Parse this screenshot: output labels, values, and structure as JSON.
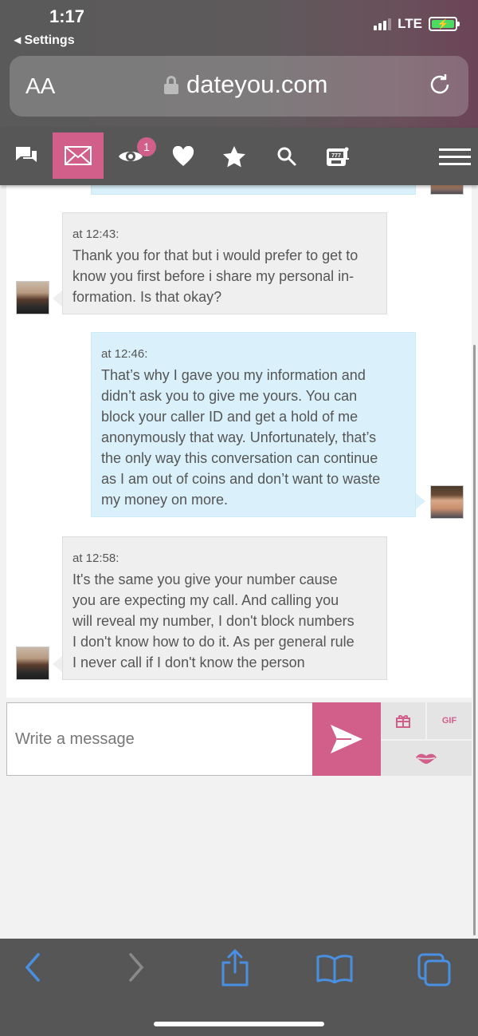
{
  "status": {
    "time": "1:17",
    "back_label": "◂ Settings",
    "network": "LTE"
  },
  "browser": {
    "text_size_label": "AA",
    "domain": "dateyou.com"
  },
  "nav": {
    "items": [
      "messages-icon",
      "mail-icon",
      "eye-icon",
      "heart-icon",
      "star-icon",
      "search-icon",
      "slot-machine-icon",
      "menu-icon"
    ],
    "active": "mail-icon",
    "views_badge": "1"
  },
  "chat": {
    "messages": [
      {
        "sender": "her",
        "time": "at 12:43:",
        "text": "Thank you for that but i would prefer to get to\nknow you first before i share my personal in-\nformation. Is that okay?"
      },
      {
        "sender": "me",
        "time": "at 12:46:",
        "text": "That’s why I gave you my information and\ndidn’t ask you to give me yours. You can\nblock your caller ID and get a hold of me\nanonymously that way. Unfortunately, that’s\nthe only way this conversation can continue\nas I am out of coins and don’t want to waste\nmy money on more."
      },
      {
        "sender": "her",
        "time": "at 12:58:",
        "text": "It's the same you give your number cause\nyou are expecting my call. And calling you\nwill reveal my number, I don't block numbers\nI don't know how to do it. As per general rule\nI never call if I don't know the person"
      }
    ]
  },
  "composer": {
    "placeholder": "Write a message",
    "gif_label": "GIF"
  },
  "colors": {
    "accent": "#d25e8a",
    "nav_bg": "#575757",
    "incoming_bubble": "#efefef",
    "outgoing_bubble": "#daf1fb"
  }
}
